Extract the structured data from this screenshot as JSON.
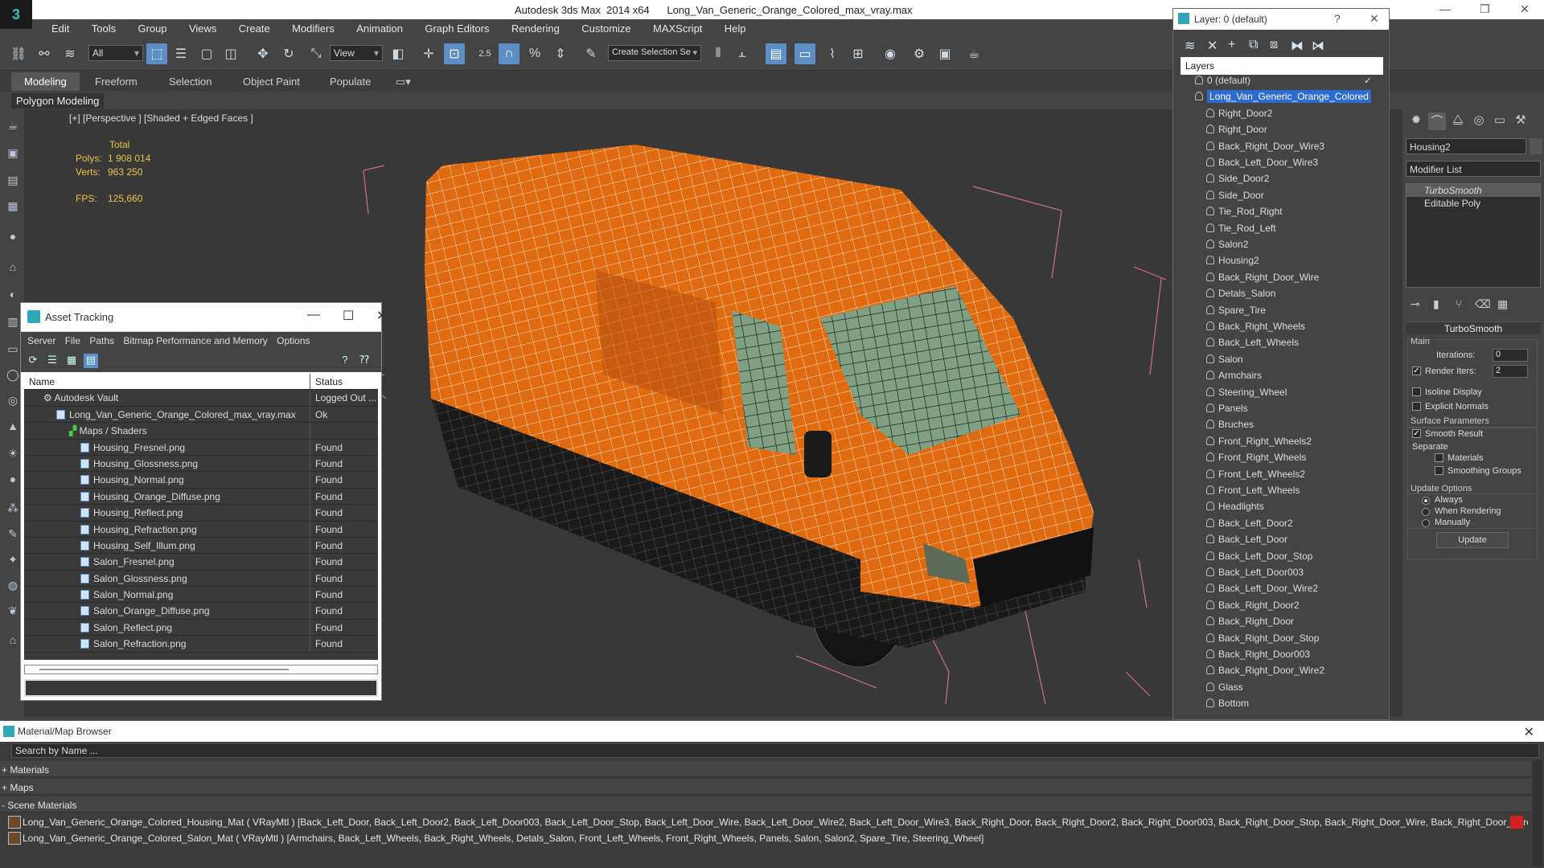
{
  "window": {
    "app_title": "Autodesk 3ds Max  2014 x64",
    "file_title": "Long_Van_Generic_Orange_Colored_max_vray.max"
  },
  "menu": [
    "Edit",
    "Tools",
    "Group",
    "Views",
    "Create",
    "Modifiers",
    "Animation",
    "Graph Editors",
    "Rendering",
    "Customize",
    "MAXScript",
    "Help"
  ],
  "toolbar": {
    "selection_filter": "All",
    "ref_coord": "View",
    "named_selection_placeholder": "Create Selection Se",
    "angle_snap_label": "2.5"
  },
  "ribbon": {
    "tabs": [
      "Modeling",
      "Freeform",
      "Selection",
      "Object Paint",
      "Populate"
    ],
    "active_tab": "Modeling",
    "sub_label": "Polygon Modeling"
  },
  "viewport": {
    "label": "[+] [Perspective ] [Shaded + Edged Faces ]",
    "stats": {
      "total_label": "Total",
      "polys_label": "Polys:",
      "polys_value": "1 908 014",
      "verts_label": "Verts:",
      "verts_value": "963 250",
      "fps_label": "FPS:",
      "fps_value": "125,660"
    },
    "object_color": "#e06a10"
  },
  "asset_tracking": {
    "title": "Asset Tracking",
    "menu": [
      "Server",
      "File",
      "Paths",
      "Bitmap Performance and Memory",
      "Options"
    ],
    "columns": {
      "name": "Name",
      "status": "Status"
    },
    "rows": [
      {
        "name": "Autodesk Vault",
        "status": "Logged Out ..."
      },
      {
        "name": "Long_Van_Generic_Orange_Colored_max_vray.max",
        "status": "Ok"
      },
      {
        "name": "Maps / Shaders",
        "status": ""
      },
      {
        "name": "Housing_Fresnel.png",
        "status": "Found"
      },
      {
        "name": "Housing_Glossness.png",
        "status": "Found"
      },
      {
        "name": "Housing_Normal.png",
        "status": "Found"
      },
      {
        "name": "Housing_Orange_Diffuse.png",
        "status": "Found"
      },
      {
        "name": "Housing_Reflect.png",
        "status": "Found"
      },
      {
        "name": "Housing_Refraction.png",
        "status": "Found"
      },
      {
        "name": "Housing_Self_Illum.png",
        "status": "Found"
      },
      {
        "name": "Salon_Fresnel.png",
        "status": "Found"
      },
      {
        "name": "Salon_Glossness.png",
        "status": "Found"
      },
      {
        "name": "Salon_Normal.png",
        "status": "Found"
      },
      {
        "name": "Salon_Orange_Diffuse.png",
        "status": "Found"
      },
      {
        "name": "Salon_Reflect.png",
        "status": "Found"
      },
      {
        "name": "Salon_Refraction.png",
        "status": "Found"
      }
    ]
  },
  "layers": {
    "title": "Layer: 0 (default)",
    "header": "Layers",
    "items": [
      "0 (default)",
      "Long_Van_Generic_Orange_Colored",
      "Right_Door2",
      "Right_Door",
      "Back_Right_Door_Wire3",
      "Back_Left_Door_Wire3",
      "Side_Door2",
      "Side_Door",
      "Tie_Rod_Right",
      "Tie_Rod_Left",
      "Salon2",
      "Housing2",
      "Back_Right_Door_Wire",
      "Detals_Salon",
      "Spare_Tire",
      "Back_Right_Wheels",
      "Back_Left_Wheels",
      "Salon",
      "Armchairs",
      "Steering_Wheel",
      "Panels",
      "Bruches",
      "Front_Right_Wheels2",
      "Front_Right_Wheels",
      "Front_Left_Wheels2",
      "Front_Left_Wheels",
      "Headlights",
      "Back_Left_Door2",
      "Back_Left_Door",
      "Back_Left_Door_Stop",
      "Back_Left_Door003",
      "Back_Left_Door_Wire2",
      "Back_Right_Door2",
      "Back_Right_Door",
      "Back_Right_Door_Stop",
      "Back_Right_Door003",
      "Back_Right_Door_Wire2",
      "Glass",
      "Bottom"
    ]
  },
  "command_panel": {
    "object_name": "Housing2",
    "modifier_list": "Modifier List",
    "stack": [
      "TurboSmooth",
      "Editable Poly"
    ],
    "rollout": "TurboSmooth",
    "main_label": "Main",
    "iterations_label": "Iterations:",
    "iterations_value": "0",
    "render_iters_label": "Render Iters:",
    "render_iters_value": "2",
    "isoline_display": "Isoline Display",
    "explicit_normals": "Explicit Normals",
    "surface_params": "Surface Parameters",
    "smooth_result": "Smooth Result",
    "separate": "Separate",
    "materials": "Materials",
    "smoothing_groups": "Smoothing Groups",
    "update_options": "Update Options",
    "always": "Always",
    "when_rendering": "When Rendering",
    "manually": "Manually",
    "update_button": "Update"
  },
  "material_browser": {
    "title": "Material/Map Browser",
    "search_placeholder": "Search by Name ...",
    "groups": [
      "+ Materials",
      "+ Maps",
      "- Scene Materials"
    ],
    "materials": [
      "Long_Van_Generic_Orange_Colored_Housing_Mat ( VRayMtl ) [Back_Left_Door, Back_Left_Door2, Back_Left_Door003, Back_Left_Door_Stop, Back_Left_Door_Wire, Back_Left_Door_Wire2, Back_Left_Door_Wire3, Back_Right_Door, Back_Right_Door2, Back_Right_Door003, Back_Right_Door_Stop, Back_Right_Door_Wire, Back_Right_Door_Wire2, Back_Right_Door...",
      "Long_Van_Generic_Orange_Colored_Salon_Mat ( VRayMtl ) [Armchairs, Back_Left_Wheels, Back_Right_Wheels, Detals_Salon, Front_Left_Wheels, Front_Right_Wheels, Panels, Salon, Salon2, Spare_Tire, Steering_Wheel]"
    ]
  }
}
